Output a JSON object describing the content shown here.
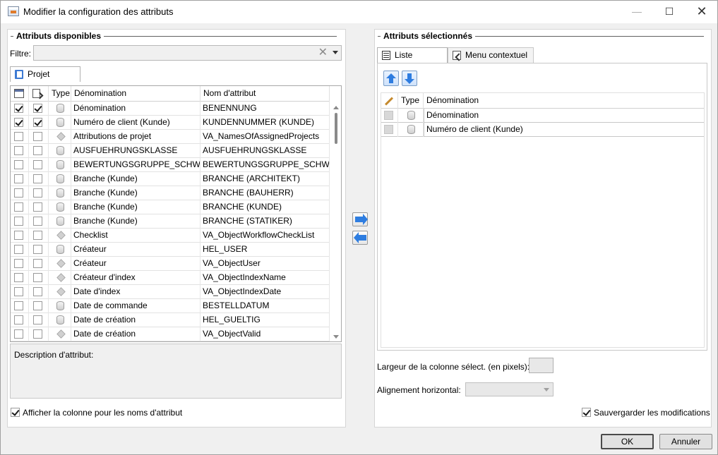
{
  "window": {
    "title": "Modifier la configuration des attributs",
    "min_glyph": "—",
    "max_glyph": "☐",
    "close_glyph": "✕"
  },
  "left": {
    "group_title": "Attributs disponibles",
    "filter_label": "Filtre:",
    "filter_value": "",
    "filter_clear_glyph": "✕",
    "tab_label": "Projet",
    "columns": {
      "type": "Type",
      "name": "Dénomination",
      "attr": "Nom d'attribut"
    },
    "rows": [
      {
        "vis": true,
        "sel": true,
        "icon": "database-icon",
        "name": "Dénomination",
        "attr": "BENENNUNG"
      },
      {
        "vis": true,
        "sel": true,
        "icon": "database-icon",
        "name": "Numéro de client (Kunde)",
        "attr": "KUNDENNUMMER (KUNDE)"
      },
      {
        "vis": false,
        "sel": false,
        "icon": "cube-icon",
        "name": "Attributions de projet",
        "attr": "VA_NamesOfAssignedProjects"
      },
      {
        "vis": false,
        "sel": false,
        "icon": "database-icon",
        "name": "AUSFUEHRUNGSKLASSE",
        "attr": "AUSFUEHRUNGSKLASSE"
      },
      {
        "vis": false,
        "sel": false,
        "icon": "database-icon",
        "name": "BEWERTUNGSGRUPPE_SCHWEISSN",
        "attr": "BEWERTUNGSGRUPPE_SCHWEISSN"
      },
      {
        "vis": false,
        "sel": false,
        "icon": "database-icon",
        "name": "Branche (Kunde)",
        "attr": "BRANCHE (ARCHITEKT)"
      },
      {
        "vis": false,
        "sel": false,
        "icon": "database-icon",
        "name": "Branche (Kunde)",
        "attr": "BRANCHE (BAUHERR)"
      },
      {
        "vis": false,
        "sel": false,
        "icon": "database-icon",
        "name": "Branche (Kunde)",
        "attr": "BRANCHE (KUNDE)"
      },
      {
        "vis": false,
        "sel": false,
        "icon": "database-icon",
        "name": "Branche (Kunde)",
        "attr": "BRANCHE (STATIKER)"
      },
      {
        "vis": false,
        "sel": false,
        "icon": "cube-icon",
        "name": "Checklist",
        "attr": "VA_ObjectWorkflowCheckList"
      },
      {
        "vis": false,
        "sel": false,
        "icon": "database-icon",
        "name": "Créateur",
        "attr": "HEL_USER"
      },
      {
        "vis": false,
        "sel": false,
        "icon": "cube-icon",
        "name": "Créateur",
        "attr": "VA_ObjectUser"
      },
      {
        "vis": false,
        "sel": false,
        "icon": "cube-icon",
        "name": "Créateur d'index",
        "attr": "VA_ObjectIndexName"
      },
      {
        "vis": false,
        "sel": false,
        "icon": "cube-icon",
        "name": "Date d'index",
        "attr": "VA_ObjectIndexDate"
      },
      {
        "vis": false,
        "sel": false,
        "icon": "database-icon",
        "name": "Date de commande",
        "attr": "BESTELLDATUM"
      },
      {
        "vis": false,
        "sel": false,
        "icon": "database-icon",
        "name": "Date de création",
        "attr": "HEL_GUELTIG"
      },
      {
        "vis": false,
        "sel": false,
        "icon": "cube-icon",
        "name": "Date de création",
        "attr": "VA_ObjectValid"
      }
    ],
    "description_label": "Description d'attribut:",
    "show_attr_col": {
      "checked": true,
      "label": "Afficher la colonne pour les noms d'attribut"
    }
  },
  "right": {
    "group_title": "Attributs sélectionnés",
    "tabs": [
      {
        "label": "Liste",
        "active": true
      },
      {
        "label": "Menu contextuel",
        "active": false
      }
    ],
    "columns": {
      "type": "Type",
      "name": "Dénomination"
    },
    "rows": [
      {
        "name": "Dénomination"
      },
      {
        "name": "Numéro de client (Kunde)"
      }
    ],
    "width_label": "Largeur de la colonne sélect. (en pixels):",
    "width_value": "",
    "align_label": "Alignement horizontal:",
    "align_value": "",
    "save_changes": {
      "checked": true,
      "label": "Sauvergarder les modifications"
    }
  },
  "buttons": {
    "ok": "OK",
    "cancel": "Annuler"
  }
}
